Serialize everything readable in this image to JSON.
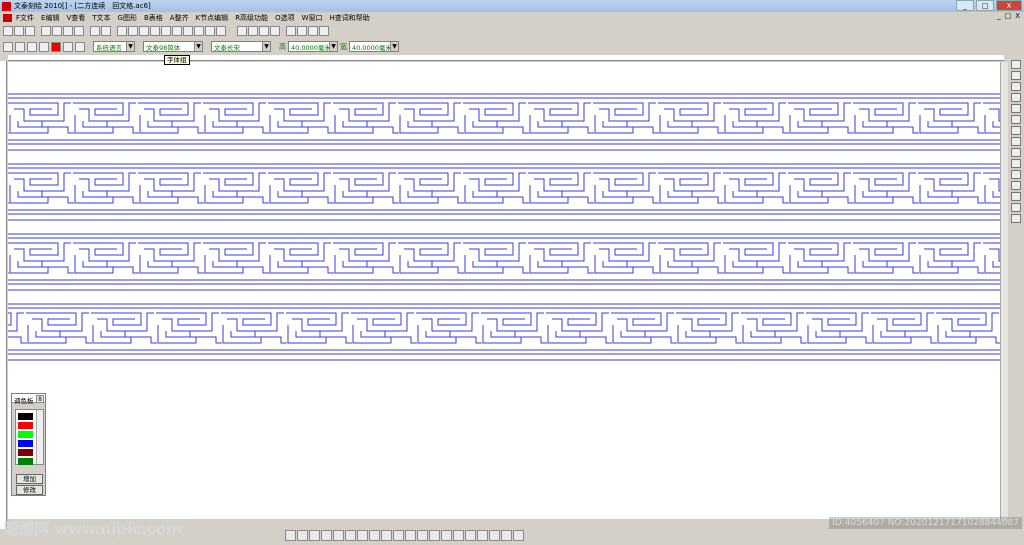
{
  "window": {
    "title": "文泰刻绘 2010[] - [二方连续　回文格.ac6]",
    "controls": [
      "_",
      "□",
      "X"
    ]
  },
  "menu": {
    "items": [
      "F文件",
      "E编辑",
      "V查看",
      "T文本",
      "G图形",
      "B表格",
      "A整齐",
      "K节点编辑",
      "R高级功能",
      "O选项",
      "W窗口",
      "H查词和帮助"
    ],
    "mdi_controls": [
      "_",
      "□",
      "X"
    ]
  },
  "toolbar": {
    "lang_select": "系统语言",
    "font_select": "文泰98简体",
    "font2_select": "文泰长宋",
    "height_label": "高",
    "height_value": "40.0000毫米",
    "width_label": "宽",
    "width_value": "40.0000毫米",
    "tooltip": "字体组"
  },
  "palette": {
    "title": "调色板",
    "close": "8",
    "colors": [
      "#000000",
      "#ff0000",
      "#00ff00",
      "#0000ff",
      "#800000",
      "#008000"
    ],
    "add_button": "增加",
    "modify_button": "修改"
  },
  "pattern": {
    "line_color": "#3a3ae0",
    "bands": 4
  },
  "watermark": {
    "left": "昵图网 www.nipic.com",
    "right": "ID:4056407 NO:20201217171028844087"
  }
}
